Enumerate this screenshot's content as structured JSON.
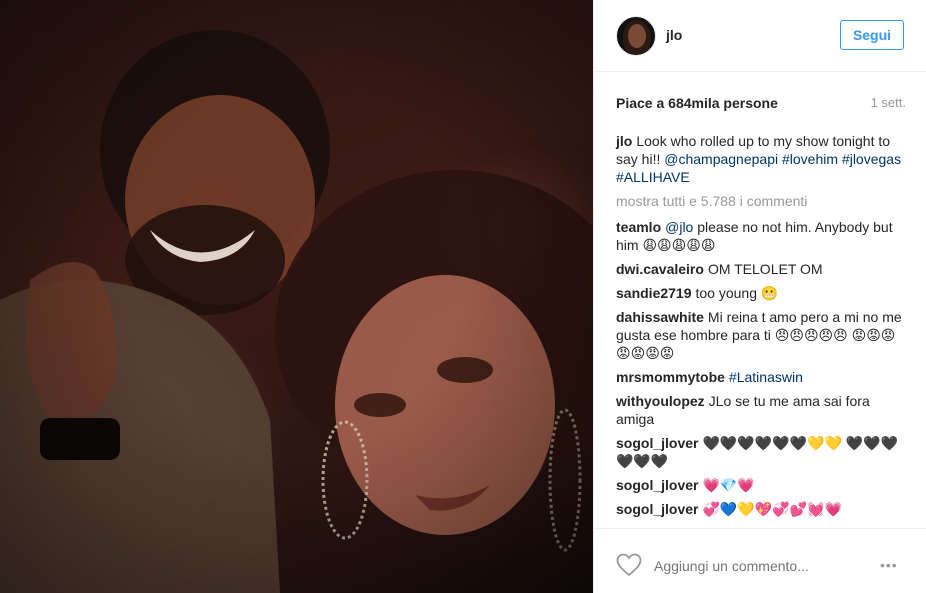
{
  "header": {
    "username": "jlo",
    "follow_label": "Segui"
  },
  "likes": {
    "text": "Piace a 684mila persone",
    "time": "1 sett."
  },
  "caption": {
    "user": "jlo",
    "text": "Look who rolled up to my show tonight to say hi!! ",
    "mention": "@champagnepapi",
    "tags": "#lovehim #jlovegas #ALLIHAVE"
  },
  "more_comments": "mostra tutti e 5.788 i commenti",
  "comments": [
    {
      "user": "teamlo",
      "mention": "@jlo",
      "text": " please no not him. Anybody but him 😩😩😩😩😩"
    },
    {
      "user": "dwi.cavaleiro",
      "text": "OM TELOLET OM"
    },
    {
      "user": "sandie2719",
      "text": "too young 😬"
    },
    {
      "user": "dahissawhite",
      "text": "Mi reina t amo pero a mi no me gusta ese hombre para ti 😠😠😠😠😠 😡😡😡😡😡😡😡"
    },
    {
      "user": "mrsmommytobe",
      "tag": "#Latinaswin"
    },
    {
      "user": "withyoulopez",
      "text": "JLo se tu me ama sai fora amiga"
    },
    {
      "user": "sogol_jlover",
      "text": "🖤🖤🖤🖤🖤🖤💛💛 🖤🖤🖤🖤🖤🖤"
    },
    {
      "user": "sogol_jlover",
      "text": "💗💎💗"
    },
    {
      "user": "sogol_jlover",
      "text": "💞💙💛💖💞💕💓💗"
    }
  ],
  "add_comment": {
    "placeholder": "Aggiungi un commento..."
  },
  "icons": {
    "like": "heart-icon",
    "options": "more-options-icon"
  },
  "colors": {
    "accent": "#3897f0",
    "link": "#003569",
    "muted": "#999999"
  }
}
